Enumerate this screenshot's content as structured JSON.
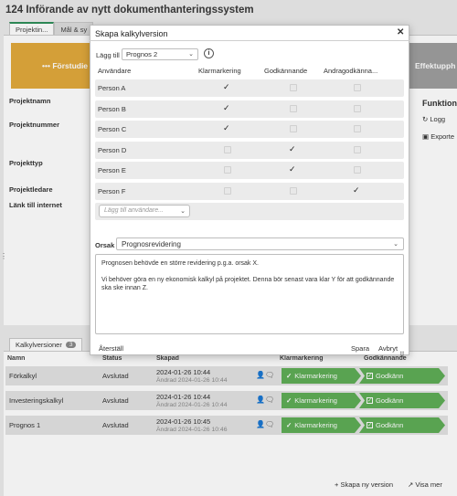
{
  "page": {
    "title": "124 Införande av nytt dokumenthanteringssystem",
    "tabs": [
      "Projektin...",
      "Mål & sy"
    ],
    "phases": {
      "left": "Förstudie",
      "right": "Effektupph"
    },
    "fields": [
      "Projektnamn",
      "Projektnummer",
      "Projekttyp",
      "Projektledare",
      "Länk till internet"
    ],
    "functions": {
      "title": "Funktioner",
      "items": [
        "Logg",
        "Exporte"
      ]
    }
  },
  "kalkyl": {
    "tab_label": "Kalkylversioner",
    "count": "3",
    "headers": {
      "name": "Namn",
      "status": "Status",
      "created": "Skapad",
      "check": "Klarmarkering",
      "approve": "Godkännande"
    },
    "rows": [
      {
        "name": "Förkalkyl",
        "status": "Avslutad",
        "created": "2024-01-26 10:44",
        "changed": "Ändrad 2024-01-26 10:44"
      },
      {
        "name": "Investeringskalkyl",
        "status": "Avslutad",
        "created": "2024-01-26 10:44",
        "changed": "Ändrad 2024-01-26 10:44"
      },
      {
        "name": "Prognos 1",
        "status": "Avslutad",
        "created": "2024-01-26 10:45",
        "changed": "Ändrad 2024-01-26 10:46"
      }
    ],
    "stage_labels": {
      "check": "Klarmarkering",
      "approve": "Godkänn"
    },
    "create_link": "Skapa ny version",
    "show_more": "Visa mer"
  },
  "modal": {
    "title": "Skapa kalkylversion",
    "add_to_label": "Lägg till",
    "add_to_value": "Prognos 2",
    "col_users": "Användare",
    "col_check": "Klarmarkering",
    "col_approve": "Godkännande",
    "col_approve2": "Andragodkänna...",
    "users": [
      {
        "name": "Person A",
        "check": true,
        "approve": false,
        "approve2": false
      },
      {
        "name": "Person B",
        "check": true,
        "approve": false,
        "approve2": false
      },
      {
        "name": "Person C",
        "check": true,
        "approve": false,
        "approve2": false
      },
      {
        "name": "Person D",
        "check": false,
        "approve": true,
        "approve2": false
      },
      {
        "name": "Person E",
        "check": false,
        "approve": true,
        "approve2": false
      },
      {
        "name": "Person F",
        "check": false,
        "approve": false,
        "approve2": true
      }
    ],
    "add_user_placeholder": "Lägg till användare...",
    "reason_label": "Orsak",
    "reason_value": "Prognosrevidering",
    "text_line1": "Prognosen behövde en större revidering p.g.a. orsak X.",
    "text_line2": "Vi behöver göra en ny ekonomisk kalkyl på projektet. Denna bör senast vara klar Y för att godkännande ska ske innan Z.",
    "reset": "Återställ",
    "save": "Spara",
    "cancel": "Avbryt"
  }
}
